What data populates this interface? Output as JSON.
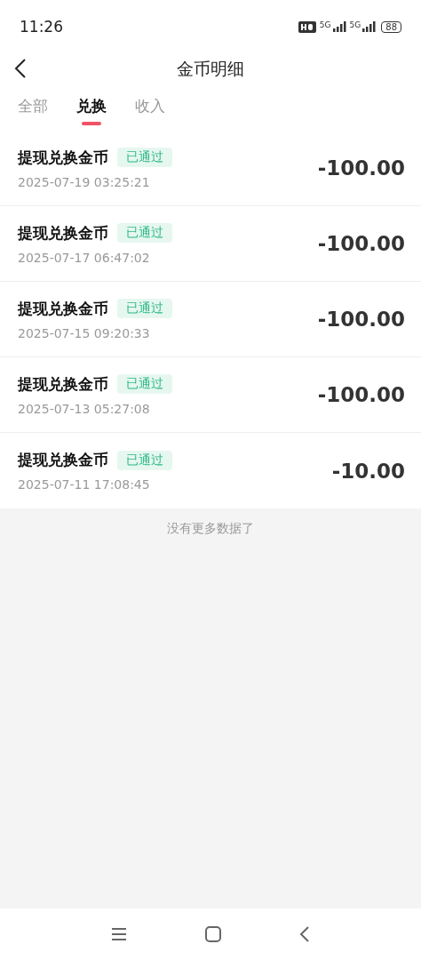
{
  "status_bar": {
    "time": "11:26",
    "network_labels": [
      "5G",
      "5G"
    ],
    "battery": "88"
  },
  "header": {
    "title": "金币明细"
  },
  "tabs": [
    {
      "label": "全部",
      "selected": false
    },
    {
      "label": "兑换",
      "selected": true
    },
    {
      "label": "收入",
      "selected": false
    }
  ],
  "records": [
    {
      "title": "提现兑换金币",
      "status": "已通过",
      "date": "2025-07-19 03:25:21",
      "amount": "-100.00"
    },
    {
      "title": "提现兑换金币",
      "status": "已通过",
      "date": "2025-07-17 06:47:02",
      "amount": "-100.00"
    },
    {
      "title": "提现兑换金币",
      "status": "已通过",
      "date": "2025-07-15 09:20:33",
      "amount": "-100.00"
    },
    {
      "title": "提现兑换金币",
      "status": "已通过",
      "date": "2025-07-13 05:27:08",
      "amount": "-100.00"
    },
    {
      "title": "提现兑换金币",
      "status": "已通过",
      "date": "2025-07-11 17:08:45",
      "amount": "-10.00"
    }
  ],
  "footer_note": "没有更多数据了"
}
